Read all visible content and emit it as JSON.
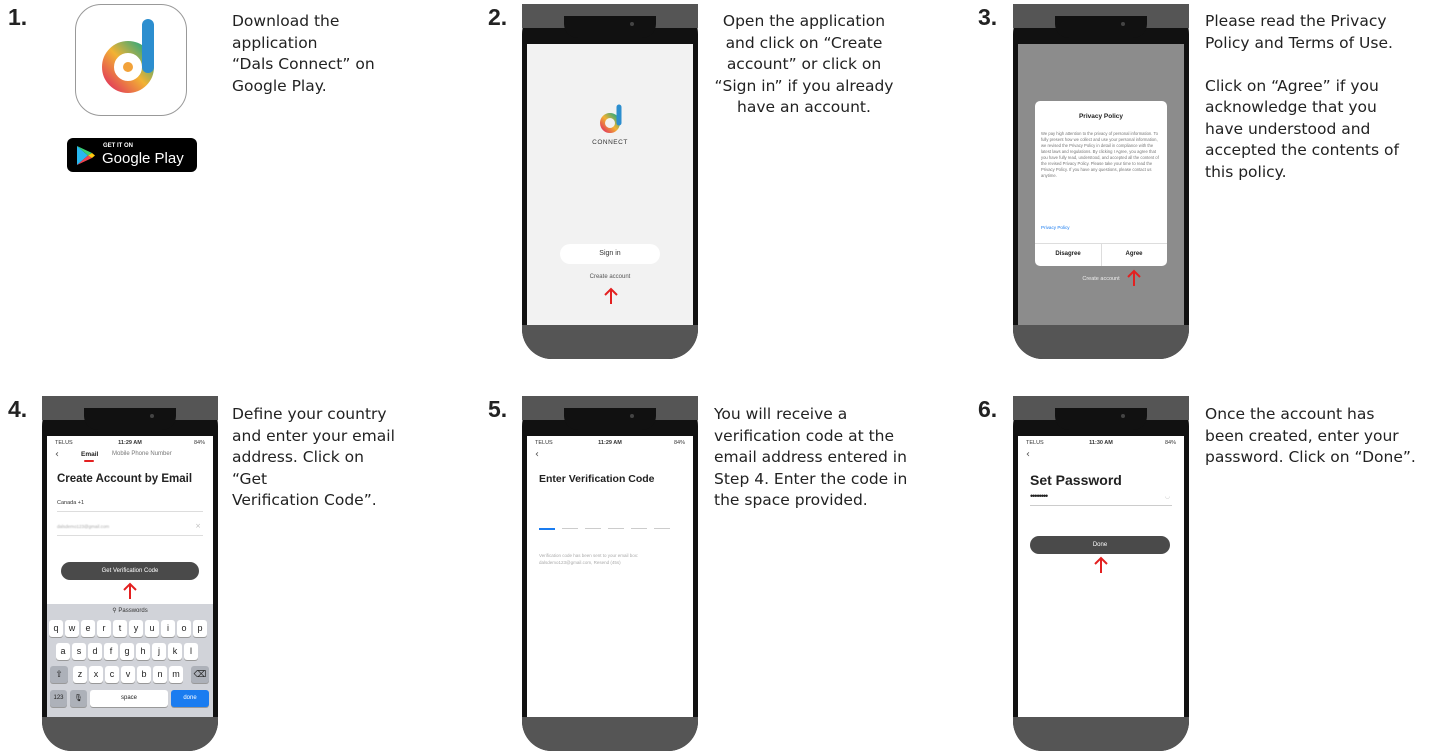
{
  "steps": [
    {
      "num": "1.",
      "text": "Download the\napplication\n“Dals Connect” on\nGoogle Play."
    },
    {
      "num": "2.",
      "text": "Open the application\nand click on “Create\naccount” or click on\n“Sign in” if you already\nhave an account."
    },
    {
      "num": "3.",
      "text": "Please read the Privacy\nPolicy and Terms of Use.\n\nClick on “Agree” if you\nacknowledge that you\nhave understood and\naccepted the contents of\nthis policy."
    },
    {
      "num": "4.",
      "text": "Define your country\nand enter your email\naddress. Click on “Get\nVerification Code”."
    },
    {
      "num": "5.",
      "text": "You will receive a\nverification code at the\nemail address entered in\nStep 4. Enter the code in\nthe space provided."
    },
    {
      "num": "6.",
      "text": "Once the account has\nbeen created, enter your\npassword. Click on “Done”."
    }
  ],
  "google_play": {
    "small": "GET IT ON",
    "big": "Google Play"
  },
  "screen2": {
    "logo_text": "CONNECT",
    "sign_in": "Sign in",
    "create_account": "Create account"
  },
  "screen3": {
    "title": "Privacy Policy",
    "body": "We pay high attention to the privacy of personal information. To fully present how we collect and use your personal information, we revised the Privacy Policy in detail in compliance with the latest laws and regulations. By clicking I Agree, you agree that you have fully read, understood, and accepted all the content of the revised Privacy Policy. Please take your time to read the Privacy Policy. If you have any questions, please contact us anytime.",
    "link": "Privacy Policy",
    "disagree": "Disagree",
    "agree": "Agree",
    "create_account": "Create account"
  },
  "screen4": {
    "carrier": "TELUS",
    "time": "11:29 AM",
    "battery": "84%",
    "tab_email": "Email",
    "tab_phone": "Mobile Phone Number",
    "title": "Create Account by Email",
    "country": "Canada +1",
    "email_value": "dalsdemo123@gmail.com",
    "button": "Get Verification Code",
    "passwords": "Passwords",
    "row1": [
      "q",
      "w",
      "e",
      "r",
      "t",
      "y",
      "u",
      "i",
      "o",
      "p"
    ],
    "row2": [
      "a",
      "s",
      "d",
      "f",
      "g",
      "h",
      "j",
      "k",
      "l"
    ],
    "row3": [
      "z",
      "x",
      "c",
      "v",
      "b",
      "n",
      "m"
    ],
    "k123": "123",
    "space": "space",
    "done": "done"
  },
  "screen5": {
    "carrier": "TELUS",
    "time": "11:29 AM",
    "battery": "84%",
    "title": "Enter Verification Code",
    "note": "Verification code has been sent to your email box:",
    "note2": "dalsdemo123@gmail.com, Resend (45s)"
  },
  "screen6": {
    "carrier": "TELUS",
    "time": "11:30 AM",
    "battery": "84%",
    "title": "Set Password",
    "password_mask": "••••••••",
    "done": "Done"
  },
  "colors": {
    "arrow": "#e32020",
    "blue": "#1a7cf0",
    "dark_button": "#4a4a4a"
  }
}
